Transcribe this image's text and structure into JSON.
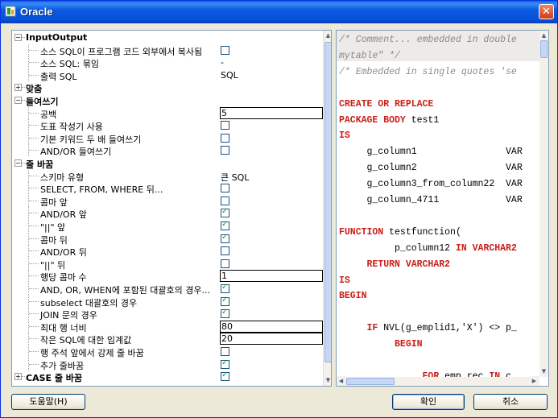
{
  "window": {
    "title": "Oracle"
  },
  "tree": {
    "rows": [
      {
        "label": "InputOutput",
        "type": "group",
        "toggle": "minus",
        "level": 0
      },
      {
        "label": "소스 SQL이 프로그램 코드 외부에서 복사됨",
        "type": "check",
        "checked": false,
        "level": 1
      },
      {
        "label": "소스 SQL: 묶임",
        "type": "value",
        "value": "-",
        "level": 1
      },
      {
        "label": "출력 SQL",
        "type": "value",
        "value": "SQL",
        "level": 1
      },
      {
        "label": "맞춤",
        "type": "group",
        "toggle": "plus",
        "level": 0
      },
      {
        "label": "들여쓰기",
        "type": "group",
        "toggle": "minus",
        "level": 0
      },
      {
        "label": "공백",
        "type": "text",
        "value": "5",
        "level": 1
      },
      {
        "label": "도표 작성기 사용",
        "type": "check",
        "checked": false,
        "level": 1
      },
      {
        "label": "기본 키워드 두 배 들여쓰기",
        "type": "check",
        "checked": false,
        "level": 1
      },
      {
        "label": "AND/OR 들여쓰기",
        "type": "check",
        "checked": false,
        "level": 1
      },
      {
        "label": "줄 바꿈",
        "type": "group",
        "toggle": "minus",
        "level": 0
      },
      {
        "label": "스키마 유형",
        "type": "value",
        "value": "큰 SQL",
        "level": 1
      },
      {
        "label": "SELECT, FROM, WHERE 뒤...",
        "type": "check",
        "checked": false,
        "level": 1
      },
      {
        "label": "콤마 앞",
        "type": "check",
        "checked": false,
        "level": 1
      },
      {
        "label": "AND/OR 앞",
        "type": "check",
        "checked": true,
        "level": 1
      },
      {
        "label": "\"||\" 앞",
        "type": "check",
        "checked": true,
        "level": 1
      },
      {
        "label": "콤마 뒤",
        "type": "check",
        "checked": true,
        "level": 1
      },
      {
        "label": "AND/OR 뒤",
        "type": "check",
        "checked": false,
        "level": 1
      },
      {
        "label": "\"||\" 뒤",
        "type": "check",
        "checked": false,
        "level": 1
      },
      {
        "label": "행당 콤마 수",
        "type": "text",
        "value": "1",
        "level": 1
      },
      {
        "label": "AND, OR, WHEN에 포함된 대괄호의 경우...",
        "type": "check",
        "checked": true,
        "level": 1
      },
      {
        "label": "subselect 대괄호의 경우",
        "type": "check",
        "checked": true,
        "level": 1
      },
      {
        "label": "JOIN 문의 경우",
        "type": "check",
        "checked": true,
        "level": 1
      },
      {
        "label": "최대 행 너비",
        "type": "text",
        "value": "80",
        "level": 1
      },
      {
        "label": "작은 SQL에 대한 임계값",
        "type": "text",
        "value": "20",
        "level": 1
      },
      {
        "label": "행 주석 앞에서 강제 줄 바꿈",
        "type": "check",
        "checked": false,
        "level": 1
      },
      {
        "label": "추가 줄바꿈",
        "type": "check",
        "checked": true,
        "level": 1
      },
      {
        "label": "CASE 줄 바꿈",
        "type": "group-check",
        "toggle": "plus",
        "checked": true,
        "level": 0
      },
      {
        "label": "공백",
        "type": "group",
        "toggle": "plus",
        "level": 0
      }
    ]
  },
  "code": {
    "lines": [
      {
        "line": 0,
        "indent": 0,
        "segments": [
          {
            "t": "/* Comment... embedded in double",
            "c": "cmt"
          }
        ]
      },
      {
        "line": 1,
        "indent": 0,
        "segments": [
          {
            "t": "mytable\" */",
            "c": "cmt"
          }
        ]
      },
      {
        "line": 2,
        "indent": 0,
        "segments": [
          {
            "t": "/* Embedded in single quotes 'se",
            "c": "cmt"
          }
        ]
      },
      {
        "line": 4,
        "indent": 0,
        "segments": [
          {
            "t": "CREATE OR REPLACE",
            "c": "kw"
          }
        ]
      },
      {
        "line": 5,
        "indent": 0,
        "segments": [
          {
            "t": "PACKAGE BODY ",
            "c": "kw"
          },
          {
            "t": "test1",
            "c": "plain"
          }
        ]
      },
      {
        "line": 6,
        "indent": 0,
        "segments": [
          {
            "t": "IS",
            "c": "kw"
          }
        ]
      },
      {
        "line": 7,
        "indent": 0,
        "segments": [
          {
            "t": "     g_column1                VAR",
            "c": "plain"
          }
        ]
      },
      {
        "line": 8,
        "indent": 0,
        "segments": [
          {
            "t": "     g_column2                VAR",
            "c": "plain"
          }
        ]
      },
      {
        "line": 9,
        "indent": 0,
        "segments": [
          {
            "t": "     g_column3_from_column22  VAR",
            "c": "plain"
          }
        ]
      },
      {
        "line": 10,
        "indent": 0,
        "segments": [
          {
            "t": "     g_column_4711            VAR",
            "c": "plain"
          }
        ]
      },
      {
        "line": 12,
        "indent": 0,
        "segments": [
          {
            "t": "FUNCTION ",
            "c": "kw"
          },
          {
            "t": "testfunction(",
            "c": "plain"
          }
        ]
      },
      {
        "line": 13,
        "indent": 0,
        "segments": [
          {
            "t": "          p_column12 ",
            "c": "plain"
          },
          {
            "t": "IN VARCHAR2",
            "c": "kw"
          }
        ]
      },
      {
        "line": 14,
        "indent": 0,
        "segments": [
          {
            "t": "     RETURN VARCHAR2",
            "c": "kw"
          }
        ]
      },
      {
        "line": 15,
        "indent": 0,
        "segments": [
          {
            "t": "IS",
            "c": "kw"
          }
        ]
      },
      {
        "line": 16,
        "indent": 0,
        "segments": [
          {
            "t": "BEGIN",
            "c": "kw"
          }
        ]
      },
      {
        "line": 18,
        "indent": 0,
        "segments": [
          {
            "t": "     IF ",
            "c": "kw"
          },
          {
            "t": "NVL(g_emplid1,'X') <> p_",
            "c": "plain"
          }
        ]
      },
      {
        "line": 19,
        "indent": 0,
        "segments": [
          {
            "t": "          BEGIN",
            "c": "kw"
          }
        ]
      },
      {
        "line": 21,
        "indent": 0,
        "segments": [
          {
            "t": "               FOR ",
            "c": "kw"
          },
          {
            "t": "emp_rec ",
            "c": "plain"
          },
          {
            "t": "IN ",
            "c": "kw"
          },
          {
            "t": "c",
            "c": "plain"
          }
        ]
      }
    ]
  },
  "buttons": {
    "help": "도움말(H)",
    "ok": "확인",
    "cancel": "취소"
  },
  "colors": {
    "keyword": "#c8201a",
    "comment": "#8a8a8a",
    "titlebar": "#0a5ae0",
    "checkmark": "#21a121"
  }
}
